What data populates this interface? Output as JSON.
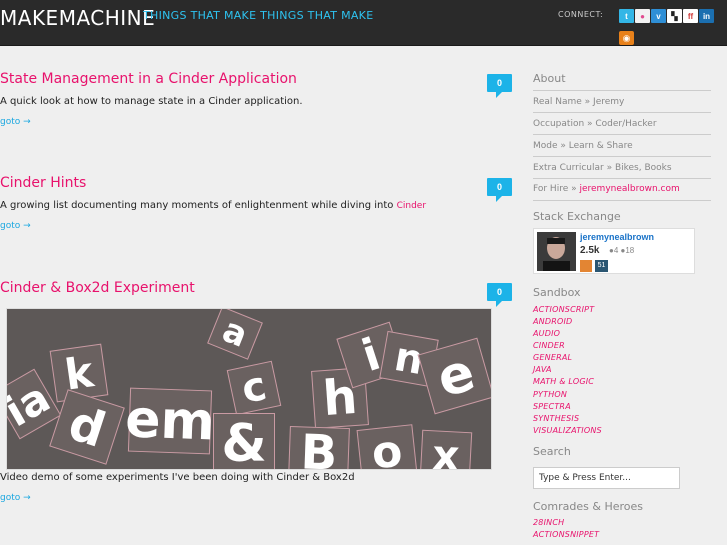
{
  "header": {
    "site_title": "MAKEMACHINE",
    "tagline": "THINGS THAT MAKE THINGS THAT MAKE",
    "connect_label": "CONNECT:",
    "social_icons": [
      "twitter-icon",
      "flickr-icon",
      "vimeo-icon",
      "delicious-icon",
      "friendfeed-icon",
      "linkedin-icon"
    ],
    "rss_icon": "rss-icon"
  },
  "posts": [
    {
      "title": "State Management in a Cinder Application",
      "excerpt": "A quick look at how to manage state in a Cinder application.",
      "goto": "goto →",
      "comments": "0"
    },
    {
      "title": "Cinder Hints",
      "excerpt": "A growing list documenting many moments of enlightenment while diving into",
      "excerpt_link": "Cinder",
      "goto": "goto →",
      "comments": "0"
    },
    {
      "title": "Cinder & Box2d Experiment",
      "excerpt": "Video demo of some experiments I've been doing with Cinder & Box2d",
      "goto": "goto →",
      "comments": "0"
    }
  ],
  "sidebar": {
    "about_heading": "About",
    "about_rows": [
      {
        "text": "Real Name » Jeremy"
      },
      {
        "text": "Occupation » Coder/Hacker"
      },
      {
        "text": "Mode » Learn & Share"
      },
      {
        "text": "Extra Curricular » Bikes, Books"
      },
      {
        "text": "For Hire » ",
        "link": "jeremynealbrown.com"
      }
    ],
    "stack_heading": "Stack Exchange",
    "stack": {
      "name": "jeremynealbrown",
      "rep": "2.5k",
      "badges": "●4 ●18",
      "icon2_label": "51"
    },
    "sandbox_heading": "Sandbox",
    "sandbox": [
      "ACTIONSCRIPT",
      "ANDROID",
      "AUDIO",
      "CINDER",
      "GENERAL",
      "JAVA",
      "MATH & LOGIC",
      "PYTHON",
      "SPECTRA",
      "SYNTHESIS",
      "VISUALIZATIONS"
    ],
    "search_heading": "Search",
    "search_value": "Type & Press Enter...",
    "comrades_heading": "Comrades & Heroes",
    "comrades": [
      "28INCH",
      "ACTIONSNIPPET"
    ]
  },
  "colors": {
    "accent_pink": "#e8126c",
    "accent_blue": "#1cb3e8",
    "header_bg": "#2a2a2a"
  }
}
